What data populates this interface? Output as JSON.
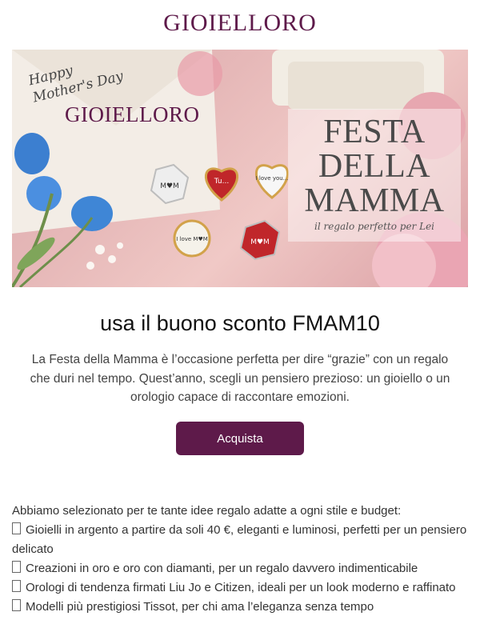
{
  "header": {
    "brand": "GIOIELLORO"
  },
  "hero": {
    "greeting": "Happy Mother's Day",
    "brand": "GIOIELLORO",
    "headline": "FESTA\nDELLA\nMAMMA",
    "subtitle": "il regalo perfetto per Lei",
    "charms": [
      {
        "text": "M♥M"
      },
      {
        "text": "Tu..."
      },
      {
        "text": "I love you..."
      },
      {
        "text": "I love M♥M"
      },
      {
        "text": "M♥M"
      }
    ]
  },
  "coupon": {
    "title": "usa il buono sconto FMAM10"
  },
  "intro": {
    "text": "La Festa della Mamma è l’occasione perfetta per dire “grazie” con un regalo che duri nel tempo. Quest’anno, scegli un pensiero prezioso: un gioiello o un orologio capace di raccontare emozioni."
  },
  "cta": {
    "label": "Acquista"
  },
  "ideas": {
    "lead": "Abbiamo selezionato per te tante idee regalo adatte a ogni stile e budget:",
    "items": [
      "Gioielli in argento a partire da soli 40 €, eleganti e luminosi, perfetti per un pensiero delicato",
      "Creazioni in oro e oro con diamanti, per un regalo davvero indimenticabile",
      "Orologi di tendenza firmati Liu Jo e Citizen, ideali per un look moderno e raffinato",
      "Modelli più prestigiosi Tissot, per chi ama l’eleganza senza tempo"
    ]
  },
  "colors": {
    "brand": "#5e1a4a",
    "button_text": "#ffffff"
  }
}
